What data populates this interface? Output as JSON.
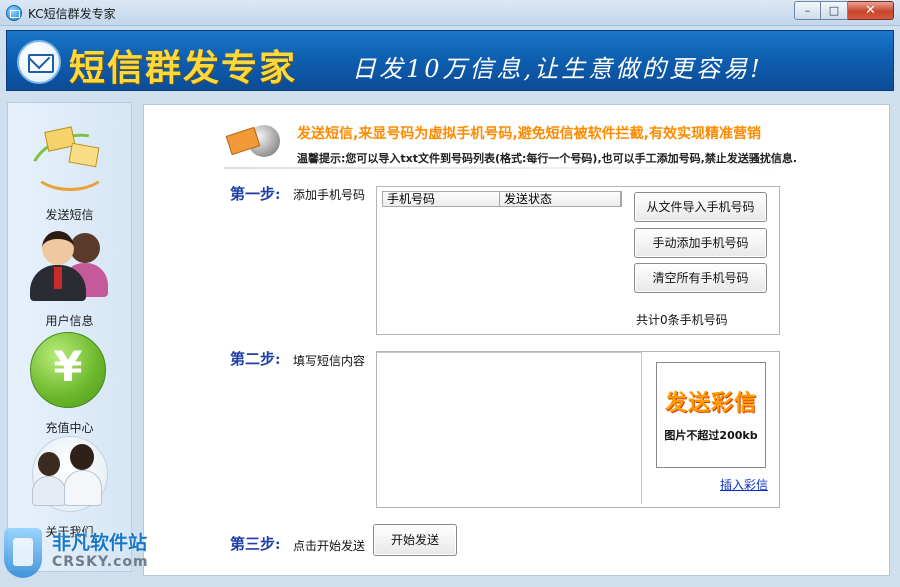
{
  "window": {
    "title": "KC短信群发专家",
    "controls": {
      "minimize": "–",
      "maximize": "□",
      "close": "✕"
    }
  },
  "banner": {
    "brand": "短信群发专家",
    "slogan": "日发10万信息,让生意做的更容易!"
  },
  "sidebar": {
    "items": [
      {
        "label": "发送短信",
        "icon": "envelope-swirl-icon"
      },
      {
        "label": "用户信息",
        "icon": "users-icon"
      },
      {
        "label": "充值中心",
        "icon": "yen-coin-icon"
      },
      {
        "label": "关于我们",
        "icon": "customer-service-icon"
      }
    ]
  },
  "notice": {
    "title": "发送短信,来显号码为虚拟手机号码,避免短信被软件拦截,有效实现精准营销",
    "tip": "温馨提示:您可以导入txt文件到号码列表(格式:每行一个号码),也可以手工添加号码,禁止发送骚扰信息."
  },
  "step1": {
    "title": "第一步:",
    "desc": "添加手机号码",
    "columns": [
      "手机号码",
      "发送状态"
    ],
    "buttons": {
      "import": "从文件导入手机号码",
      "add": "手动添加手机号码",
      "clear": "清空所有手机号码"
    },
    "count": "共计0条手机号码"
  },
  "step2": {
    "title": "第二步:",
    "desc": "填写短信内容",
    "mms_title": "发送彩信",
    "mms_sub": "图片不超过200kb",
    "insert_link": "插入彩信"
  },
  "step3": {
    "title": "第三步:",
    "desc": "点击开始发送",
    "send_button": "开始发送"
  },
  "watermark": {
    "name": "非凡软件站",
    "domain": "CRSKY.com"
  }
}
